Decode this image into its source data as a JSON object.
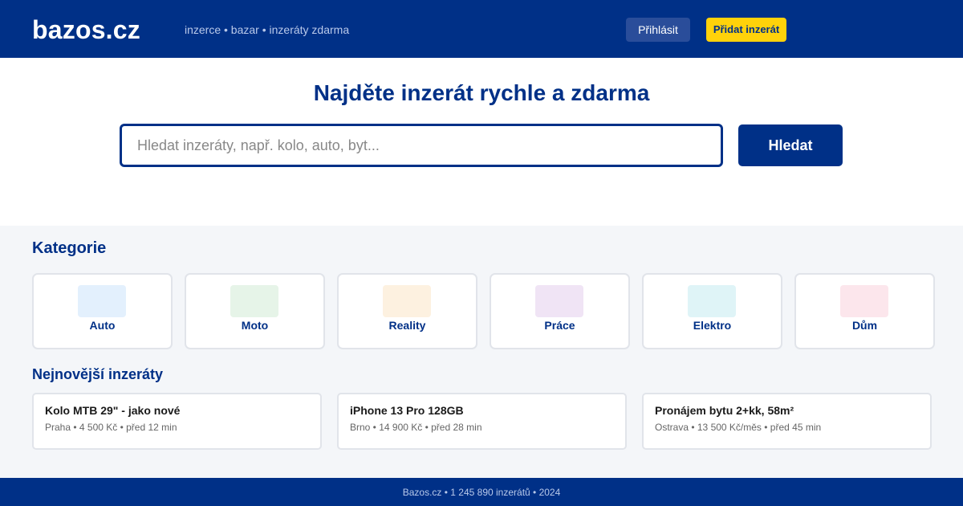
{
  "header": {
    "logo": "bazos.cz",
    "tagline": "inzerce • bazar • inzeráty zdarma",
    "login_label": "Přihlásit",
    "add_label": "Přidat inzerát"
  },
  "hero": {
    "title": "Najděte inzerát rychle a zdarma",
    "search_placeholder": "Hledat inzeráty, např. kolo, auto, byt...",
    "search_value": "",
    "search_button": "Hledat"
  },
  "categories": {
    "title": "Kategorie",
    "items": [
      {
        "label": "Auto",
        "icon": "car-icon",
        "color": "#e3f0fd"
      },
      {
        "label": "Moto",
        "icon": "motorcycle-icon",
        "color": "#e6f4e8"
      },
      {
        "label": "Reality",
        "icon": "house-icon",
        "color": "#fdf1e0"
      },
      {
        "label": "Práce",
        "icon": "briefcase-icon",
        "color": "#f0e4f5"
      },
      {
        "label": "Elektro",
        "icon": "electronics-icon",
        "color": "#dff4f7"
      },
      {
        "label": "Dům",
        "icon": "home-garden-icon",
        "color": "#fce6ec"
      }
    ]
  },
  "latest": {
    "title": "Nejnovější inzeráty",
    "items": [
      {
        "title": "Kolo MTB 29\" - jako nové",
        "meta": "Praha • 4 500 Kč • před 12 min"
      },
      {
        "title": "iPhone 13 Pro 128GB",
        "meta": "Brno • 14 900 Kč • před 28 min"
      },
      {
        "title": "Pronájem bytu 2+kk, 58m²",
        "meta": "Ostrava • 13 500 Kč/měs • před 45 min"
      }
    ]
  },
  "footer": {
    "text": "Bazos.cz • 1 245 890 inzerátů • 2024"
  },
  "colors": {
    "brand": "#003087",
    "accent": "#ffd20a"
  }
}
